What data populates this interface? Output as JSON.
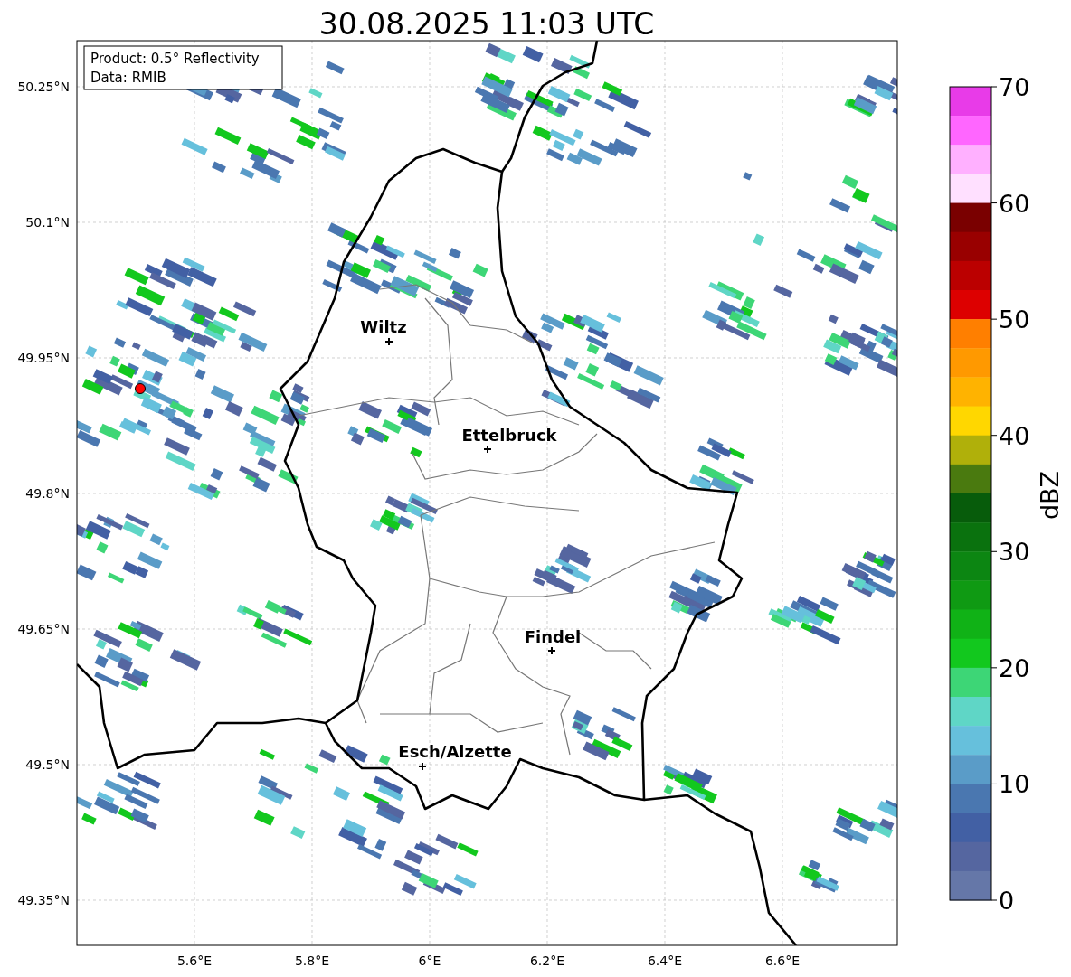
{
  "title": "30.08.2025 11:03 UTC",
  "legend": [
    "Product: 0.5° Reflectivity",
    "Data: RMIB"
  ],
  "x_ticks": [
    "5.6°E",
    "5.8°E",
    "6°E",
    "6.2°E",
    "6.4°E",
    "6.6°E"
  ],
  "y_ticks": [
    "50.25°N",
    "50.1°N",
    "49.95°N",
    "49.8°N",
    "49.65°N",
    "49.5°N",
    "49.35°N"
  ],
  "cities": [
    {
      "name": "Wiltz"
    },
    {
      "name": "Ettelbruck"
    },
    {
      "name": "Findel"
    },
    {
      "name": "Esch/Alzette"
    }
  ],
  "colorbar": {
    "label": "dBZ",
    "ticks": [
      "70",
      "60",
      "50",
      "40",
      "30",
      "20",
      "10",
      "0"
    ],
    "levels": [
      {
        "color": "#e83be8"
      },
      {
        "color": "#ff66ff"
      },
      {
        "color": "#ffb0ff"
      },
      {
        "color": "#ffe0ff"
      },
      {
        "color": "#7a0000"
      },
      {
        "color": "#990000"
      },
      {
        "color": "#bb0000"
      },
      {
        "color": "#dd0000"
      },
      {
        "color": "#ff7f00"
      },
      {
        "color": "#ff9900"
      },
      {
        "color": "#ffb300"
      },
      {
        "color": "#ffd700"
      },
      {
        "color": "#b0b00a"
      },
      {
        "color": "#4a7a0f"
      },
      {
        "color": "#075c0b"
      },
      {
        "color": "#0a720e"
      },
      {
        "color": "#0c8612"
      },
      {
        "color": "#0f9a13"
      },
      {
        "color": "#10b216"
      },
      {
        "color": "#12c81e"
      },
      {
        "color": "#3dd676"
      },
      {
        "color": "#5fd6c6"
      },
      {
        "color": "#66c0dc"
      },
      {
        "color": "#5a9cc8"
      },
      {
        "color": "#4a77b0"
      },
      {
        "color": "#4260a4"
      },
      {
        "color": "#5566a0"
      },
      {
        "color": "#6577a8"
      }
    ]
  }
}
